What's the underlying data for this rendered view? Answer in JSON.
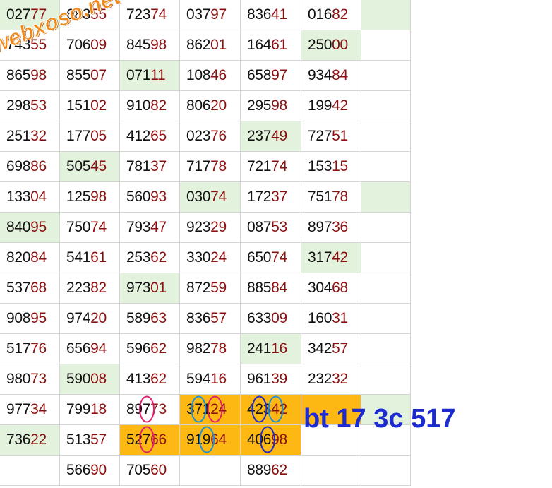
{
  "watermark": "webxoso.net",
  "note": "bt 17 3c 517",
  "colors": {
    "green": "#e3f2dc",
    "orange": "#fdb813",
    "prefix": "#111111",
    "suffix": "#8b1111",
    "note": "#1c2bd0",
    "circle_blue": "#1e90d6",
    "circle_navy": "#1c2bd0",
    "circle_red": "#e0206e"
  },
  "rows": [
    [
      "02777",
      "68355",
      "72374",
      "03797",
      "83641",
      "01682",
      ""
    ],
    [
      "74355",
      "70609",
      "84598",
      "86201",
      "16461",
      "25000",
      ""
    ],
    [
      "86598",
      "85507",
      "07111",
      "10846",
      "65897",
      "93484",
      ""
    ],
    [
      "29853",
      "15102",
      "91082",
      "80620",
      "29598",
      "19942",
      ""
    ],
    [
      "25132",
      "17705",
      "41265",
      "02376",
      "23749",
      "72751",
      ""
    ],
    [
      "69886",
      "50545",
      "78137",
      "71778",
      "72174",
      "15315",
      ""
    ],
    [
      "13304",
      "12598",
      "56093",
      "03074",
      "17237",
      "75178",
      ""
    ],
    [
      "84095",
      "75074",
      "79347",
      "92329",
      "08753",
      "89736",
      ""
    ],
    [
      "82084",
      "54161",
      "25362",
      "33024",
      "65074",
      "31742",
      ""
    ],
    [
      "53768",
      "22382",
      "97301",
      "87259",
      "88584",
      "30468",
      ""
    ],
    [
      "90895",
      "97420",
      "58963",
      "83657",
      "63309",
      "16031",
      ""
    ],
    [
      "51776",
      "65694",
      "59662",
      "98278",
      "24116",
      "34257",
      ""
    ],
    [
      "98073",
      "59008",
      "41362",
      "59416",
      "96139",
      "23232",
      ""
    ],
    [
      "97734",
      "79918",
      "89773",
      "37124",
      "42342",
      "",
      ""
    ],
    [
      "73622",
      "51357",
      "52766",
      "91964",
      "40698",
      "",
      ""
    ],
    [
      "",
      "56690",
      "70560",
      "",
      "88962",
      "",
      ""
    ]
  ],
  "highlights": [
    [
      "g",
      "",
      "",
      "",
      "",
      "",
      "g"
    ],
    [
      "",
      "",
      "",
      "",
      "",
      "g",
      ""
    ],
    [
      "",
      "",
      "g",
      "",
      "",
      "",
      ""
    ],
    [
      "",
      "",
      "",
      "",
      "",
      "",
      ""
    ],
    [
      "",
      "",
      "",
      "",
      "g",
      "",
      ""
    ],
    [
      "",
      "g",
      "",
      "",
      "",
      "",
      ""
    ],
    [
      "",
      "",
      "",
      "g",
      "",
      "",
      "g"
    ],
    [
      "g",
      "",
      "",
      "",
      "",
      "",
      ""
    ],
    [
      "",
      "",
      "",
      "",
      "",
      "g",
      ""
    ],
    [
      "",
      "",
      "g",
      "",
      "",
      "",
      ""
    ],
    [
      "",
      "",
      "",
      "",
      "",
      "",
      ""
    ],
    [
      "",
      "",
      "",
      "",
      "g",
      "",
      ""
    ],
    [
      "",
      "g",
      "",
      "",
      "",
      "",
      ""
    ],
    [
      "",
      "",
      "",
      "o",
      "o",
      "o",
      "g"
    ],
    [
      "g",
      "",
      "o",
      "o",
      "o",
      "",
      ""
    ],
    [
      "",
      "",
      "",
      "",
      "",
      "",
      ""
    ]
  ],
  "circled_digits": [
    {
      "row": 13,
      "col": 2,
      "digit": 2,
      "color": "circle_red"
    },
    {
      "row": 13,
      "col": 3,
      "digit": 1,
      "color": "circle_blue"
    },
    {
      "row": 13,
      "col": 3,
      "digit": 3,
      "color": "circle_red"
    },
    {
      "row": 13,
      "col": 4,
      "digit": 1,
      "color": "circle_navy"
    },
    {
      "row": 13,
      "col": 4,
      "digit": 3,
      "color": "circle_blue"
    },
    {
      "row": 14,
      "col": 2,
      "digit": 2,
      "color": "circle_red"
    },
    {
      "row": 14,
      "col": 3,
      "digit": 2,
      "color": "circle_blue"
    },
    {
      "row": 14,
      "col": 4,
      "digit": 2,
      "color": "circle_navy"
    }
  ]
}
